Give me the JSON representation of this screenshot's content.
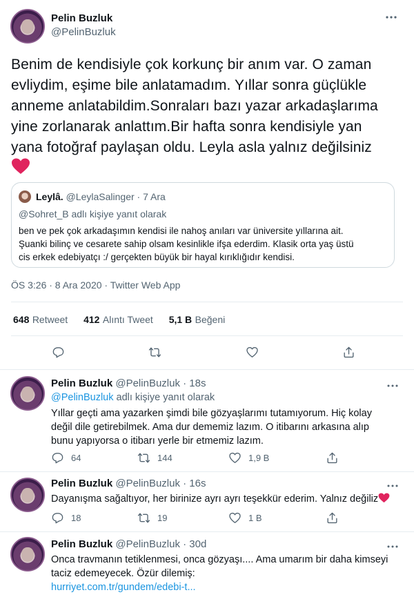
{
  "main_tweet": {
    "name": "Pelin Buzluk",
    "handle": "@PelinBuzluk",
    "text_lines": [
      "Benim de kendisiyle çok korkunç bir anım var. O zaman",
      "evliydim, eşime bile anlatamadım. Yıllar sonra güçlükle",
      "anneme anlatabildim.Sonraları bazı yazar arkadaşlarıma",
      "yine zorlanarak anlattım.Bir hafta sonra kendisiyle yan",
      "yana fotoğraf paylaşan oldu. Leyla asla yalnız değilsiniz"
    ],
    "heart_emoji": "❤️",
    "timestamp": "ÖS 3:26 · 8 Ara 2020 · Twitter Web App",
    "stats": {
      "retweets_count": "648",
      "retweets_label": "Retweet",
      "quotes_count": "412",
      "quotes_label": "Alıntı Tweet",
      "likes_count": "5,1 B",
      "likes_label": "Beğeni"
    }
  },
  "quoted_tweet": {
    "name": "Leylâ.",
    "handle": "@LeylaSalinger",
    "time": "· 7 Ara",
    "reply_context": "@Sohret_B adlı kişiye yanıt olarak",
    "text_lines": [
      "ben ve pek çok arkadaşımın kendisi ile nahoş anıları var üniversite yıllarına ait.",
      "Şuanki bilinç ve cesarete sahip olsam kesinlikle ifşa ederdim.  Klasik orta yaş üstü",
      "cis erkek edebiyatçı :/ gerçekten büyük bir hayal kırıklığıdır kendisi."
    ]
  },
  "replies": [
    {
      "name": "Pelin Buzluk",
      "handle": "@PelinBuzluk",
      "time": "· 18s",
      "reply_mention": "@PelinBuzluk",
      "reply_suffix": "adlı kişiye yanıt olarak",
      "text_lines": [
        "Yıllar geçti ama yazarken şimdi bile gözyaşlarımı tutamıyorum. Hiç kolay",
        "değil dile getirebilmek. Ama dur dememiz lazım. O itibarını arkasına alıp",
        "bunu yapıyorsa o itibarı yerle bir etmemiz lazım."
      ],
      "replies_count": "64",
      "retweets_count": "144",
      "likes_count": "1,9 B"
    },
    {
      "name": "Pelin Buzluk",
      "handle": "@PelinBuzluk",
      "time": "· 16s",
      "text": "Dayanışma sağaltıyor, her birinize ayrı ayrı teşekkür ederim. Yalnız değiliz",
      "heart_emoji": "❤️",
      "replies_count": "18",
      "retweets_count": "19",
      "likes_count": "1 B"
    },
    {
      "name": "Pelin Buzluk",
      "handle": "@PelinBuzluk",
      "time": "· 30d",
      "text_lines": [
        "Onca travmanın tetiklenmesi, onca gözyaşı.... Ama umarım bir daha kimseyi",
        "taciz edemeyecek. Özür dilemiş:"
      ],
      "link": "hurriyet.com.tr/gundem/edebi-t..."
    }
  ],
  "icons": {
    "more": "more-dots-icon",
    "reply": "reply-icon",
    "retweet": "retweet-icon",
    "like": "like-icon",
    "share": "share-icon"
  },
  "colors": {
    "link": "#1b95e0",
    "heart": "#e0245e",
    "muted": "#536471",
    "border": "#cfd9de"
  }
}
